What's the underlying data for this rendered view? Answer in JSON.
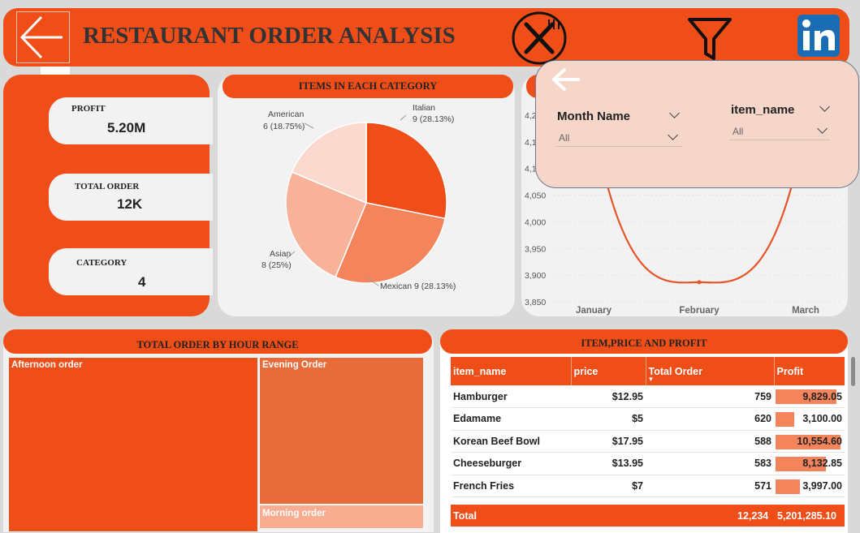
{
  "header": {
    "title": "RESTAURANT ORDER ANALYSIS"
  },
  "more_options": "...",
  "kpis": {
    "profit": {
      "label": "PROFIT",
      "value": "5.20M"
    },
    "total_order": {
      "label": "TOTAL ORDER",
      "value": "12K"
    },
    "category": {
      "label": "CATEGORY",
      "value": "4"
    }
  },
  "pie": {
    "title": "ITEMS IN EACH CATEGORY",
    "labels": {
      "italian_name": "Italian",
      "italian_val": "9 (28.13%)",
      "mexican": "Mexican 9 (28.13%)",
      "asian_name": "Asian",
      "asian_val": "8 (25%)",
      "american_name": "American",
      "american_val": "6 (18.75%)"
    }
  },
  "filters": {
    "month": {
      "label": "Month Name",
      "value": "All"
    },
    "item": {
      "label": "item_name",
      "value": "All"
    }
  },
  "treemap": {
    "title": "TOTAL ORDER BY HOUR RANGE",
    "afternoon": "Afternoon order",
    "evening": "Evening Order",
    "morning": "Morning order"
  },
  "table": {
    "title": "ITEM,PRICE AND PROFIT",
    "headers": {
      "item": "item_name",
      "price": "price",
      "orders": "Total Order",
      "profit": "Profit"
    },
    "rows": [
      {
        "item": "Hamburger",
        "price": "$12.95",
        "orders": "759",
        "profit": "9,829.05"
      },
      {
        "item": "Edamame",
        "price": "$5",
        "orders": "620",
        "profit": "3,100.00"
      },
      {
        "item": "Korean Beef Bowl",
        "price": "$17.95",
        "orders": "588",
        "profit": "10,554.60"
      },
      {
        "item": "Cheeseburger",
        "price": "$13.95",
        "orders": "583",
        "profit": "8,132.85"
      },
      {
        "item": "French Fries",
        "price": "$7",
        "orders": "571",
        "profit": "3,997.00"
      }
    ],
    "total": {
      "label": "Total",
      "orders": "12,234",
      "profit": "5,201,285.10"
    }
  },
  "chart_data": [
    {
      "type": "pie",
      "title": "ITEMS IN EACH CATEGORY",
      "categories": [
        "Italian",
        "Mexican",
        "Asian",
        "American"
      ],
      "values": [
        9,
        9,
        8,
        6
      ],
      "percent": [
        28.13,
        28.13,
        25,
        18.75
      ],
      "colors": [
        "#f04e19",
        "#f4845c",
        "#f9b29a",
        "#fbd9ce"
      ]
    },
    {
      "type": "line",
      "categories": [
        "January",
        "February",
        "March"
      ],
      "values": [
        4230,
        3892,
        4230
      ],
      "ylim": [
        3850,
        4250
      ],
      "yticks": [
        "4,2",
        "4,1",
        "4,1",
        "4,050",
        "4,000",
        "3,950",
        "3,900",
        "3,850"
      ],
      "color": "#e6552a"
    },
    {
      "type": "treemap",
      "categories": [
        "Afternoon order",
        "Evening Order",
        "Morning order"
      ]
    }
  ]
}
